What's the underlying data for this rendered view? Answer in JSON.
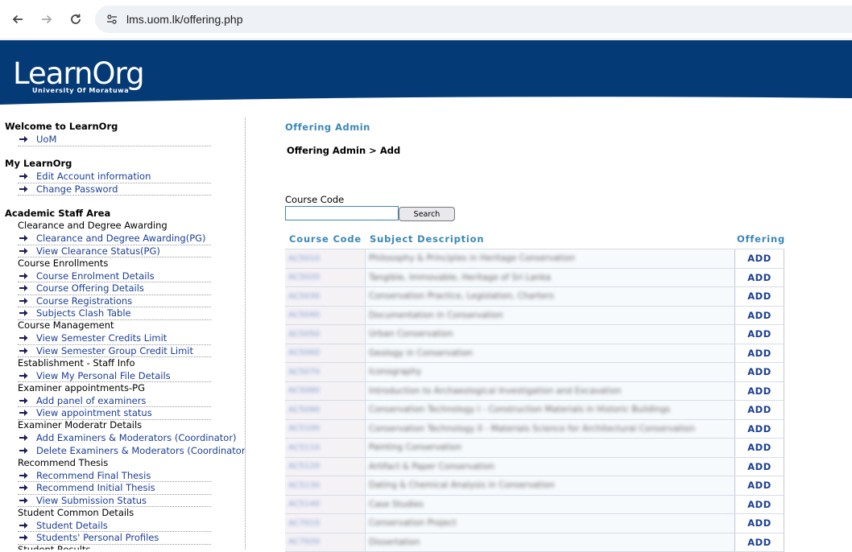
{
  "browser": {
    "url": "lms.uom.lk/offering.php"
  },
  "banner": {
    "logo_text": "LearnOrg",
    "logo_subtext": "University Of Moratuwa"
  },
  "sidebar": {
    "welcome": {
      "title": "Welcome to LearnOrg",
      "items": [
        "UoM"
      ]
    },
    "my": {
      "title": "My LearnOrg",
      "items": [
        "Edit Account information",
        "Change Password"
      ]
    },
    "academic": {
      "title": "Academic Staff Area",
      "groups": [
        {
          "title": "Clearance and Degree Awarding",
          "items": [
            "Clearance and Degree Awarding(PG)",
            "View Clearance Status(PG)"
          ]
        },
        {
          "title": "Course Enrollments",
          "items": [
            "Course Enrolment Details",
            "Course Offering Details",
            "Course Registrations",
            "Subjects Clash Table"
          ]
        },
        {
          "title": "Course Management",
          "items": [
            "View Semester Credits Limit",
            "View Semester Group Credit Limit"
          ]
        },
        {
          "title": "Establishment - Staff Info",
          "items": [
            "View My Personal File Details"
          ]
        },
        {
          "title": "Examiner appointments-PG",
          "items": [
            "Add panel of examiners",
            "View appointment status"
          ]
        },
        {
          "title": "Examiner Moderatr Details",
          "items": [
            "Add Examiners & Moderators (Coordinator)",
            "Delete Examiners & Moderators (Coordinator)"
          ]
        },
        {
          "title": "Recommend Thesis",
          "items": [
            "Recommend Final Thesis",
            "Recommend Initial Thesis",
            "View Submission Status"
          ]
        },
        {
          "title": "Student Common Details",
          "items": [
            "Student Details",
            "Students' Personal Profiles"
          ]
        },
        {
          "title": "Student Results",
          "items": []
        }
      ]
    }
  },
  "main": {
    "title": "Offering Admin",
    "breadcrumb": "Offering Admin > Add",
    "course_code_label": "Course Code",
    "course_code_value": "",
    "search_label": "Search",
    "table": {
      "headers": {
        "code": "Course Code",
        "desc": "Subject Description",
        "offering": "Offering"
      },
      "rows": [
        {
          "code": "AC5010",
          "desc": "Philosophy & Principles in Heritage Conservation",
          "action": "ADD"
        },
        {
          "code": "AC5020",
          "desc": "Tangible, Immovable, Heritage of Sri Lanka",
          "action": "ADD"
        },
        {
          "code": "AC5030",
          "desc": "Conservation Practice, Legislation, Charters",
          "action": "ADD"
        },
        {
          "code": "AC5040",
          "desc": "Documentation in Conservation",
          "action": "ADD"
        },
        {
          "code": "AC5050",
          "desc": "Urban Conservation",
          "action": "ADD"
        },
        {
          "code": "AC5060",
          "desc": "Geology in Conservation",
          "action": "ADD"
        },
        {
          "code": "AC5070",
          "desc": "Iconography",
          "action": "ADD"
        },
        {
          "code": "AC5080",
          "desc": "Introduction to Archaeological Investigation and Excavation",
          "action": "ADD"
        },
        {
          "code": "AC5090",
          "desc": "Conservation Technology I - Construction Materials in Historic Buildings",
          "action": "ADD"
        },
        {
          "code": "AC5100",
          "desc": "Conservation Technology II - Materials Science for Architectural Conservation",
          "action": "ADD"
        },
        {
          "code": "AC5110",
          "desc": "Painting Conservation",
          "action": "ADD"
        },
        {
          "code": "AC5120",
          "desc": "Artifact & Paper Conservation",
          "action": "ADD"
        },
        {
          "code": "AC5130",
          "desc": "Dating & Chemical Analysis in Conservation",
          "action": "ADD"
        },
        {
          "code": "AC5140",
          "desc": "Case Studies",
          "action": "ADD"
        },
        {
          "code": "AC7010",
          "desc": "Conservation Project",
          "action": "ADD"
        },
        {
          "code": "AC7020",
          "desc": "Dissertation",
          "action": "ADD"
        }
      ]
    }
  }
}
